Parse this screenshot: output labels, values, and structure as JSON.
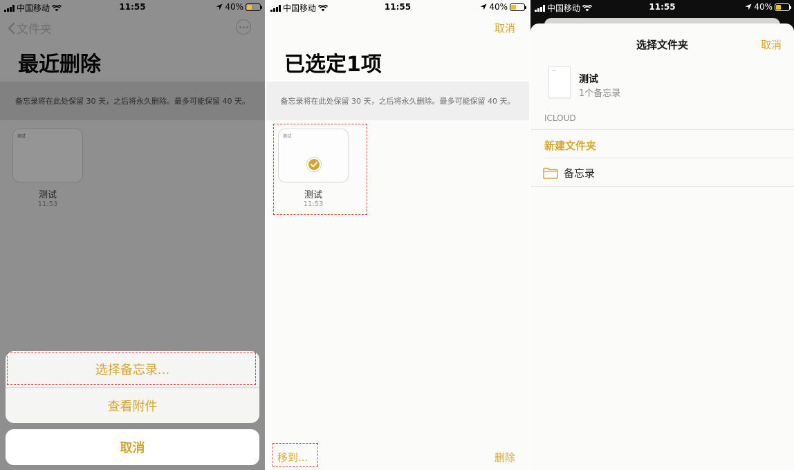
{
  "status_bar": {
    "carrier": "中国移动",
    "time": "11:55",
    "battery": "40%",
    "battery_fraction": 0.4
  },
  "left_panel": {
    "back_label": "文件夹",
    "title": "最近删除",
    "info": "备忘录将在此处保留 30 天，之后将永久删除。最多可能保留 40 天。",
    "note": {
      "thumb_title": "测试",
      "title": "测试",
      "time": "11:53"
    },
    "action_sheet": {
      "select_notes": "选择备忘录...",
      "view_attachments": "查看附件",
      "cancel": "取消"
    }
  },
  "middle_panel": {
    "cancel": "取消",
    "title": "已选定1项",
    "info": "备忘录将在此处保留 30 天，之后将永久删除。最多可能保留 40 天。",
    "note": {
      "thumb_title": "测试",
      "title": "测试",
      "time": "11:53"
    },
    "move_to": "移到...",
    "delete": "删除"
  },
  "right_panel": {
    "title": "选择文件夹",
    "cancel": "取消",
    "current_note": {
      "title": "测试",
      "count": "1个备忘录"
    },
    "section": "ICLOUD",
    "new_folder": "新建文件夹",
    "folders": [
      {
        "name": "备忘录"
      }
    ]
  },
  "colors": {
    "accent": "#d6a62c",
    "highlight": "#e23a3a"
  }
}
